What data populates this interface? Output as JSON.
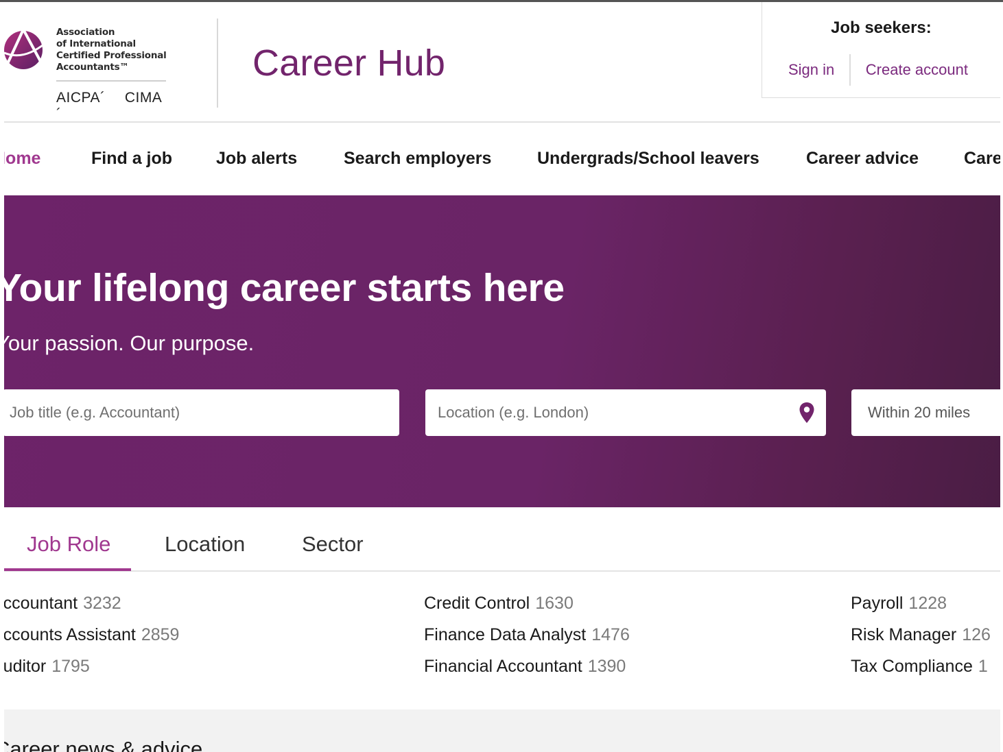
{
  "header": {
    "org_name_lines": [
      "Association",
      "of International",
      "Certified Professional",
      "Accountants™"
    ],
    "brand_1": "AICPA´",
    "brand_2": "CIMA´",
    "site_title": "Career Hub",
    "seekers": {
      "title": "Job seekers:",
      "sign_in": "Sign in",
      "create_account": "Create account"
    }
  },
  "nav": {
    "items": [
      "Home",
      "Find a job",
      "Job alerts",
      "Search employers",
      "Undergrads/School leavers",
      "Career advice",
      "Care"
    ],
    "active": "Home"
  },
  "hero": {
    "title": "Your lifelong career starts here",
    "subtitle": "Your passion. Our purpose.",
    "job_placeholder": "Job title (e.g. Accountant)",
    "location_placeholder": "Location (e.g. London)",
    "radius": "Within 20 miles"
  },
  "tabs": {
    "items": [
      "Job Role",
      "Location",
      "Sector"
    ],
    "active": "Job Role"
  },
  "listings": {
    "col1": [
      {
        "label": "Accountant",
        "count": "3232"
      },
      {
        "label": "Accounts Assistant",
        "count": "2859"
      },
      {
        "label": "Auditor",
        "count": "1795"
      }
    ],
    "col2": [
      {
        "label": "Credit Control",
        "count": "1630"
      },
      {
        "label": "Finance Data Analyst",
        "count": "1476"
      },
      {
        "label": "Financial Accountant",
        "count": "1390"
      }
    ],
    "col3": [
      {
        "label": "Payroll",
        "count": "1228"
      },
      {
        "label": "Risk Manager",
        "count": "126"
      },
      {
        "label": "Tax Compliance",
        "count": "1"
      }
    ]
  },
  "news": {
    "title": "Career news & advice"
  },
  "colors": {
    "brand_purple": "#72246c",
    "accent_magenta": "#a0388f",
    "hero_bg": "#6d2369"
  },
  "icons": {
    "logo": "aicpa-cima-logo",
    "location": "map-pin-icon"
  }
}
